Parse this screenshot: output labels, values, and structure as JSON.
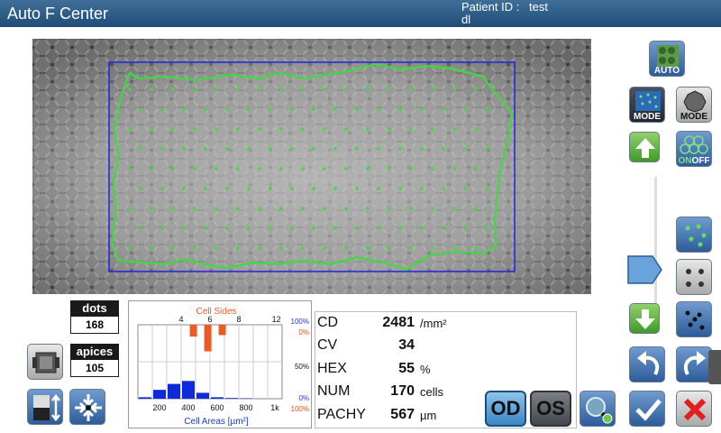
{
  "header": {
    "title": "Auto F Center",
    "patient_id_label": "Patient ID :",
    "patient_id_value": "test",
    "patient_sub": "dl"
  },
  "counts": {
    "dots_label": "dots",
    "dots_value": "168",
    "apices_label": "apices",
    "apices_value": "105"
  },
  "histogram": {
    "title": "Cell Sides",
    "side_ticks": [
      "4",
      "6",
      "8",
      "12"
    ],
    "area_ticks": [
      "200",
      "400",
      "600",
      "800",
      "1k"
    ],
    "xlabel": "Cell Areas [µm²]",
    "right_labels": {
      "top_blue": "100%",
      "top_orange": "0%",
      "mid": "50%",
      "bot_blue": "0%",
      "bot_orange": "100%"
    },
    "colors": {
      "sides": "#ee5a24",
      "areas": "#0d2bd6"
    }
  },
  "chart_data": {
    "type": "bar",
    "title": "Cell Sides",
    "xlabel": "Cell Areas [µm²]",
    "series": [
      {
        "name": "Cell Sides",
        "categories": [
          "5",
          "6",
          "7"
        ],
        "values": [
          8,
          18,
          7
        ]
      },
      {
        "name": "Cell Areas",
        "categories": [
          "100",
          "200",
          "300",
          "400",
          "500",
          "600",
          "700",
          "800",
          "900",
          "1000"
        ],
        "values": [
          1,
          6,
          10,
          12,
          4,
          1,
          0.5,
          0.3,
          0,
          0
        ]
      }
    ],
    "ylim": [
      0,
      100
    ]
  },
  "metrics": [
    {
      "label": "CD",
      "value": "2481",
      "unit": "/mm²"
    },
    {
      "label": "CV",
      "value": "34",
      "unit": ""
    },
    {
      "label": "HEX",
      "value": "55",
      "unit": "%"
    },
    {
      "label": "NUM",
      "value": "170",
      "unit": "cells"
    },
    {
      "label": "PACHY",
      "value": "567",
      "unit": "µm"
    }
  ],
  "buttons": {
    "auto_label": "AUTO",
    "mode_label": "MODE",
    "mode2_label": "MODE",
    "onoff_on": "ON",
    "onoff_off": "OFF",
    "od_label": "OD",
    "os_label": "OS"
  },
  "slider": {
    "level": 0.3
  }
}
